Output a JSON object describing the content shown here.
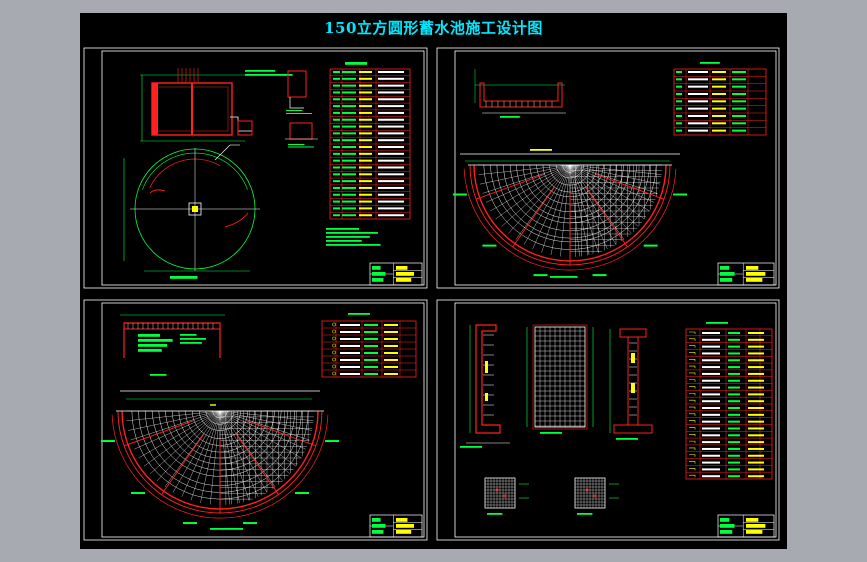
{
  "title": "150立方圆形蓄水池施工设计图",
  "colors": {
    "background": "#000000",
    "frame": "#ffffff",
    "title": "#00e8ff",
    "concrete": "#ff2020",
    "dimension": "#00ff40",
    "rebar": "#ffffff",
    "annotation": "#ffff00",
    "accent": "#ff00ff",
    "outer_bg": "#a7abb1"
  },
  "sheets": [
    {
      "id": "sheet-1",
      "content": "plan-and-section-with-material-table"
    },
    {
      "id": "sheet-2",
      "content": "bottom-slab-reinforcement-half-plan"
    },
    {
      "id": "sheet-3",
      "content": "top-slab-reinforcement-half-plan"
    },
    {
      "id": "sheet-4",
      "content": "wall-and-column-reinforcement-details"
    }
  ]
}
